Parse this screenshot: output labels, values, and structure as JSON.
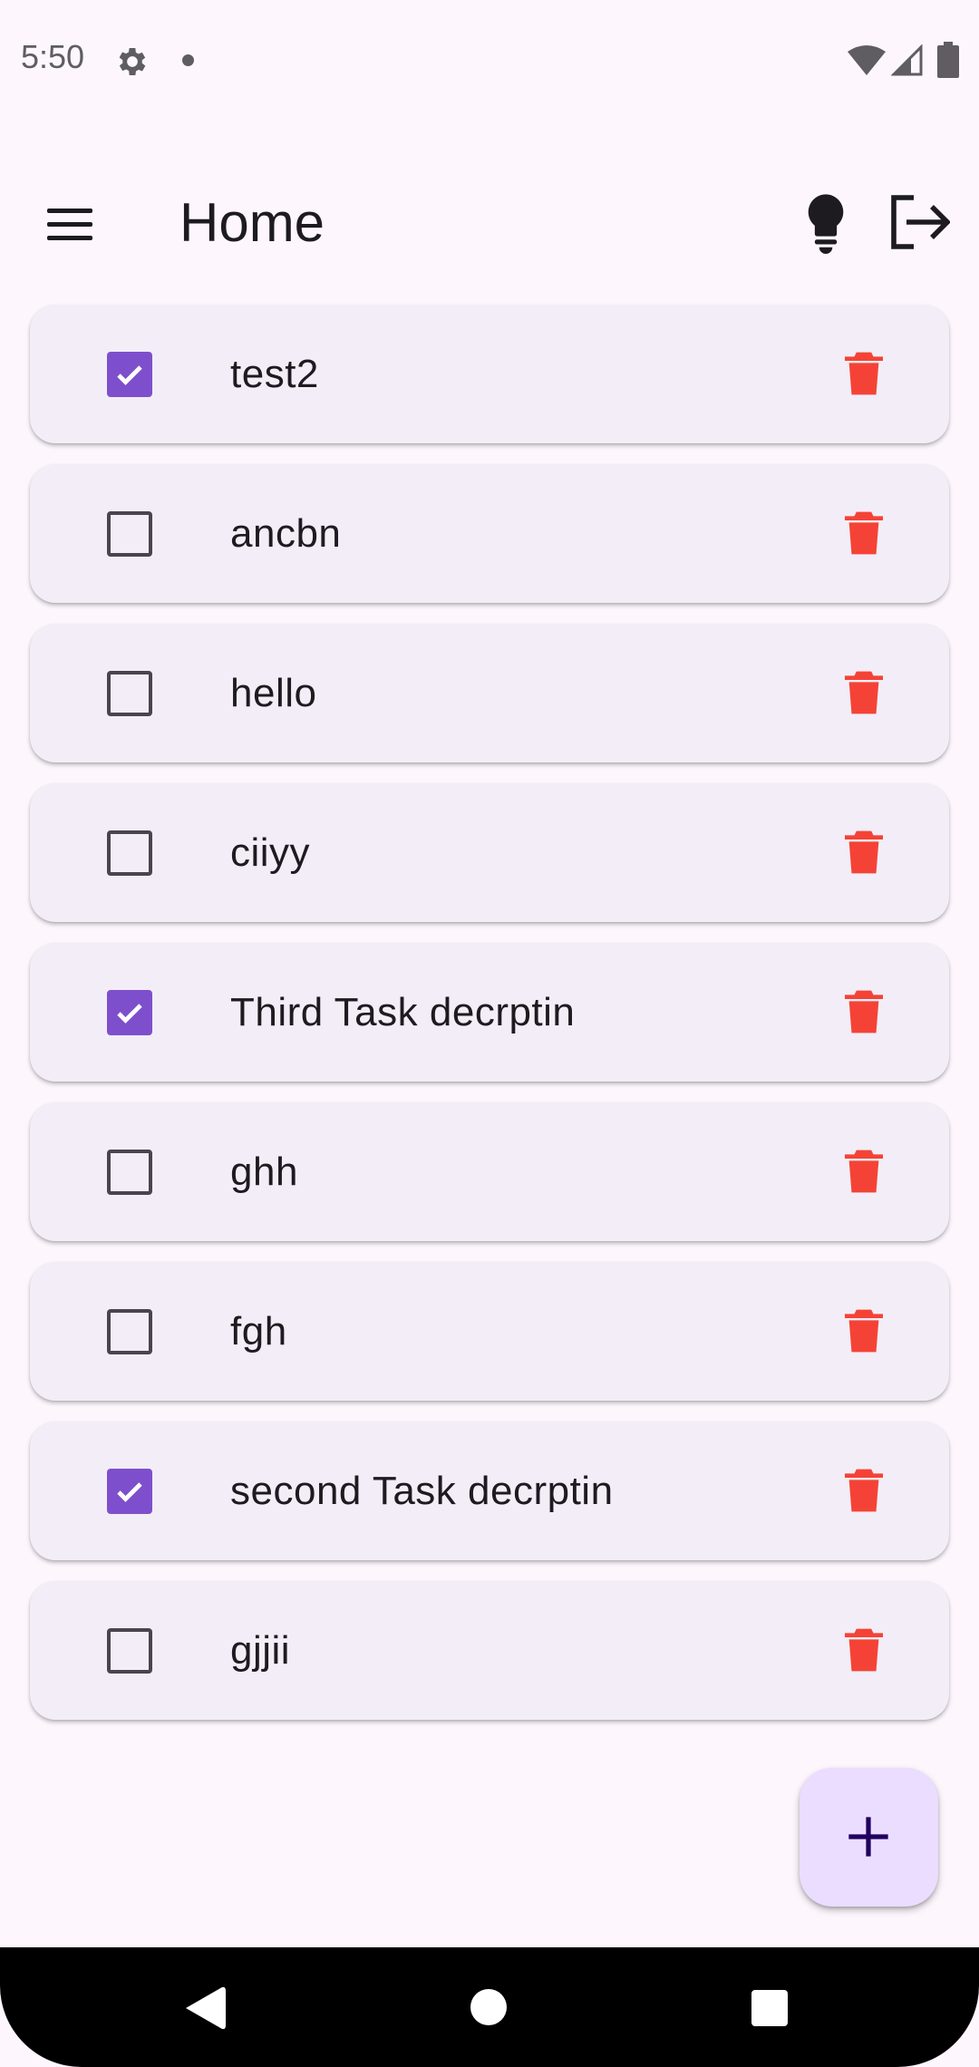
{
  "status_bar": {
    "time": "5:50",
    "icons": [
      "settings-gear-icon",
      "notification-dot-icon",
      "wifi-icon",
      "cell-signal-icon",
      "battery-icon"
    ]
  },
  "app_bar": {
    "title": "Home",
    "menu_icon": "menu-icon",
    "actions": [
      "lightbulb-icon",
      "logout-icon"
    ]
  },
  "tasks": [
    {
      "label": "test2",
      "checked": true
    },
    {
      "label": "ancbn",
      "checked": false
    },
    {
      "label": "hello",
      "checked": false
    },
    {
      "label": "ciiyy",
      "checked": false
    },
    {
      "label": "Third Task decrptin",
      "checked": true
    },
    {
      "label": "ghh",
      "checked": false
    },
    {
      "label": "fgh",
      "checked": false
    },
    {
      "label": "second Task decrptin",
      "checked": true
    },
    {
      "label": "gjjii",
      "checked": false
    }
  ],
  "fab": {
    "icon": "plus-icon"
  },
  "nav_bar": {
    "buttons": [
      "back-icon",
      "home-icon",
      "recents-icon"
    ]
  },
  "colors": {
    "background": "#fdf7fd",
    "card": "#f3edf7",
    "checkbox_checked": "#7e4fcc",
    "delete": "#f44336",
    "fab": "#eaddff"
  }
}
